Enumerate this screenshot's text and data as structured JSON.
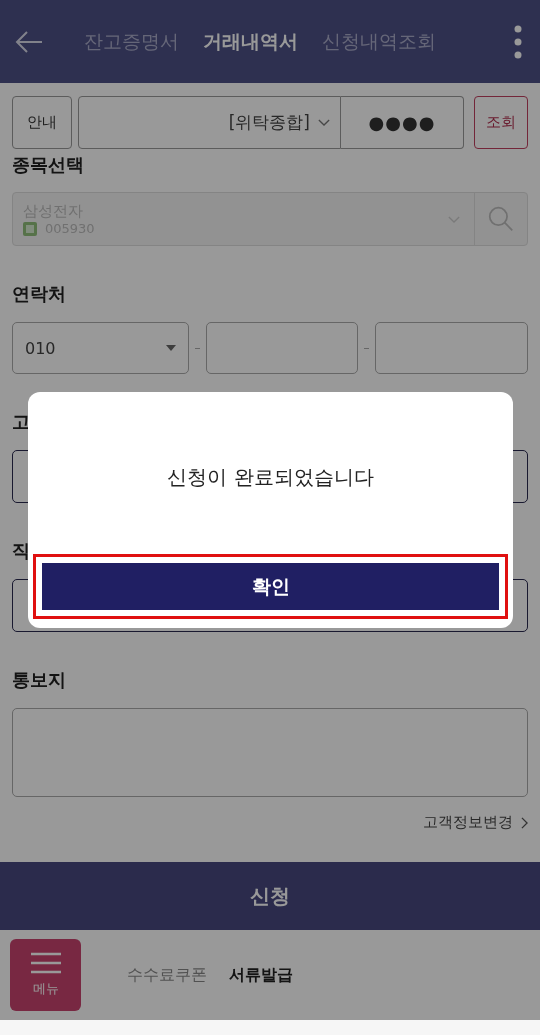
{
  "header": {
    "tabs": [
      {
        "label": "잔고증명서",
        "selected": false
      },
      {
        "label": "거래내역서",
        "selected": true
      },
      {
        "label": "신청내역조회",
        "selected": false
      }
    ]
  },
  "toolbar": {
    "info_button": "안내",
    "account": "[위탁종합]",
    "password": "●●●●",
    "search_button": "조회"
  },
  "stock": {
    "label": "종목선택",
    "name": "삼성전자",
    "code": "005930",
    "disabled": true
  },
  "contact": {
    "label": "연락처",
    "prefix": "010"
  },
  "field_3": {
    "label": "고"
  },
  "field_4": {
    "label": "직"
  },
  "notice": {
    "label": "통보지"
  },
  "customer_info_link": "고객정보변경",
  "submit_button": "신청",
  "bottom_nav": {
    "menu_button": "메뉴",
    "items": [
      {
        "label": "수수료쿠폰",
        "selected": false
      },
      {
        "label": "서류발급",
        "selected": true
      }
    ]
  },
  "dialog": {
    "message": "신청이 완료되었습니다",
    "confirm_button": "확인",
    "highlighted": true
  }
}
